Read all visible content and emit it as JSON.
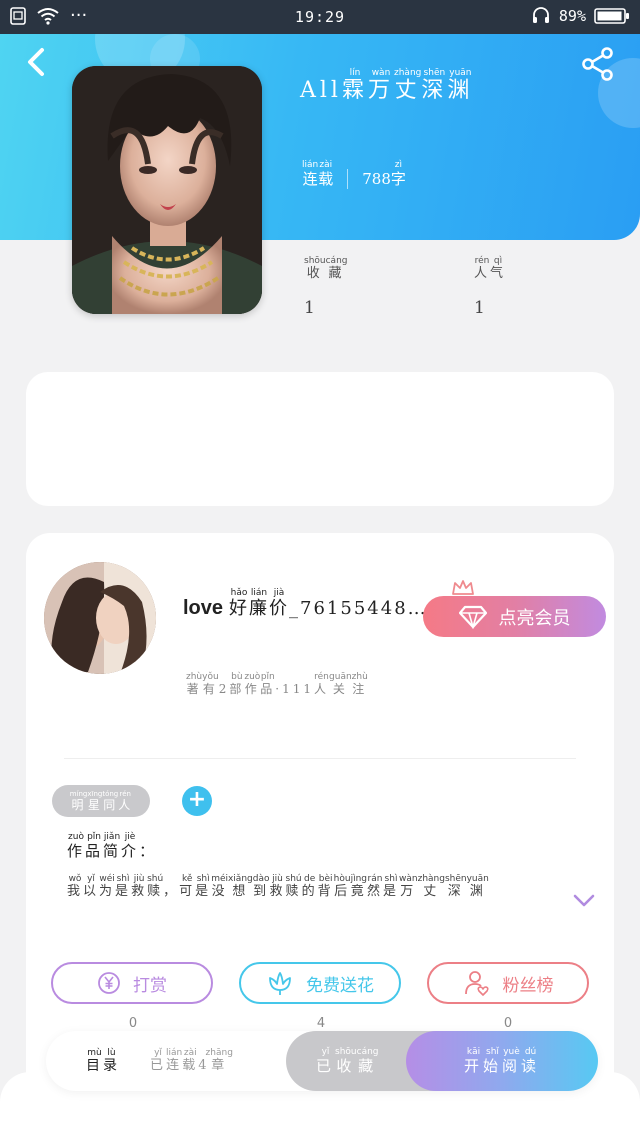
{
  "status_bar": {
    "time": "19:29",
    "battery": "89%",
    "dots": "···"
  },
  "book": {
    "title_latin": "All",
    "title_chars": [
      {
        "char": "霖",
        "pinyin": "lín"
      },
      {
        "char": "万",
        "pinyin": "wàn"
      },
      {
        "char": "丈",
        "pinyin": "zhàng"
      },
      {
        "char": "深",
        "pinyin": "shēn"
      },
      {
        "char": "渊",
        "pinyin": "yuān"
      }
    ],
    "status_chars": [
      {
        "char": "连",
        "pinyin": "lián"
      },
      {
        "char": "载",
        "pinyin": "zài"
      }
    ],
    "word_count_number": "788",
    "word_count_unit": {
      "char": "字",
      "pinyin": "zì"
    }
  },
  "stats": {
    "favorites_label": [
      {
        "char": "收",
        "pinyin": "shōu"
      },
      {
        "char": "藏",
        "pinyin": "cáng"
      }
    ],
    "favorites_value": "1",
    "popularity_label": [
      {
        "char": "人",
        "pinyin": "rén"
      },
      {
        "char": "气",
        "pinyin": "qì"
      }
    ],
    "popularity_value": "1"
  },
  "author": {
    "name_latin": "love",
    "name_chars": [
      {
        "char": "好",
        "pinyin": "hǎo"
      },
      {
        "char": "廉",
        "pinyin": "lián"
      },
      {
        "char": "价",
        "pinyin": "jià"
      }
    ],
    "name_suffix": "_76155448…",
    "meta_chars": [
      {
        "char": "著",
        "pinyin": "zhù"
      },
      {
        "char": "有",
        "pinyin": "yǒu"
      },
      {
        "char": "2",
        "pinyin": ""
      },
      {
        "char": "部",
        "pinyin": "bù"
      },
      {
        "char": "作",
        "pinyin": "zuò"
      },
      {
        "char": "品",
        "pinyin": "pǐn"
      },
      {
        "char": "·",
        "pinyin": ""
      },
      {
        "char": "111",
        "pinyin": ""
      },
      {
        "char": "人",
        "pinyin": "rén"
      },
      {
        "char": "关",
        "pinyin": "guān"
      },
      {
        "char": "注",
        "pinyin": "zhù"
      }
    ],
    "vip_label": "点亮会员"
  },
  "tag": {
    "chars": [
      {
        "char": "明",
        "pinyin": "míng"
      },
      {
        "char": "星",
        "pinyin": "xīng"
      },
      {
        "char": "同",
        "pinyin": "tóng"
      },
      {
        "char": "人",
        "pinyin": "rén"
      }
    ],
    "add_label": "+"
  },
  "intro": {
    "title_chars": [
      {
        "char": "作",
        "pinyin": "zuò"
      },
      {
        "char": "品",
        "pinyin": "pǐn"
      },
      {
        "char": "简",
        "pinyin": "jiǎn"
      },
      {
        "char": "介",
        "pinyin": "jiè"
      },
      {
        "char": "：",
        "pinyin": ""
      }
    ],
    "text_chars": [
      {
        "char": "我",
        "pinyin": "wǒ"
      },
      {
        "char": "以",
        "pinyin": "yǐ"
      },
      {
        "char": "为",
        "pinyin": "wéi"
      },
      {
        "char": "是",
        "pinyin": "shì"
      },
      {
        "char": "救",
        "pinyin": "jiù"
      },
      {
        "char": "赎",
        "pinyin": "shú"
      },
      {
        "char": "，",
        "pinyin": ""
      },
      {
        "char": "可",
        "pinyin": "kě"
      },
      {
        "char": "是",
        "pinyin": "shì"
      },
      {
        "char": "没",
        "pinyin": "méi"
      },
      {
        "char": "想",
        "pinyin": "xiǎng"
      },
      {
        "char": "到",
        "pinyin": "dào"
      },
      {
        "char": "救",
        "pinyin": "jiù"
      },
      {
        "char": "赎",
        "pinyin": "shú"
      },
      {
        "char": "的",
        "pinyin": "de"
      },
      {
        "char": "背",
        "pinyin": "bèi"
      },
      {
        "char": "后",
        "pinyin": "hòu"
      },
      {
        "char": "竟",
        "pinyin": "jìng"
      },
      {
        "char": "然",
        "pinyin": "rán"
      },
      {
        "char": "是",
        "pinyin": "shì"
      },
      {
        "char": "万",
        "pinyin": "wàn"
      },
      {
        "char": "丈",
        "pinyin": "zhàng"
      },
      {
        "char": "深",
        "pinyin": "shēn"
      },
      {
        "char": "渊",
        "pinyin": "yuān"
      }
    ]
  },
  "actions": {
    "reward_label": "打赏",
    "reward_count": "0",
    "flower_label": "免费送花",
    "flower_count": "4",
    "fans_label": "粉丝榜",
    "fans_count": "0"
  },
  "bottom_bar": {
    "toc_chars": [
      {
        "char": "目",
        "pinyin": "mù"
      },
      {
        "char": "录",
        "pinyin": "lù"
      }
    ],
    "status_chars": [
      {
        "char": "已",
        "pinyin": "yǐ"
      },
      {
        "char": "连",
        "pinyin": "lián"
      },
      {
        "char": "载",
        "pinyin": "zài"
      },
      {
        "char": "4",
        "pinyin": ""
      },
      {
        "char": "章",
        "pinyin": "zhāng"
      }
    ],
    "collected_chars": [
      {
        "char": "已",
        "pinyin": "yǐ"
      },
      {
        "char": "收",
        "pinyin": "shōu"
      },
      {
        "char": "藏",
        "pinyin": "cáng"
      }
    ],
    "read_chars": [
      {
        "char": "开",
        "pinyin": "kāi"
      },
      {
        "char": "始",
        "pinyin": "shǐ"
      },
      {
        "char": "阅",
        "pinyin": "yuè"
      },
      {
        "char": "读",
        "pinyin": "dú"
      }
    ]
  },
  "colors": {
    "header_start": "#4fd4f2",
    "header_end": "#2a9ef3",
    "reward": "#b98be0",
    "flower": "#45c7ea",
    "fans": "#ec7f86",
    "tag_bg": "#c9c9cc"
  },
  "icons": {
    "back": "chevron-left-icon",
    "share": "share-icon",
    "vip": "diamond-icon",
    "reward": "yen-icon",
    "flower": "flower-icon",
    "fans": "user-heart-icon",
    "expand": "chevron-down-icon"
  }
}
